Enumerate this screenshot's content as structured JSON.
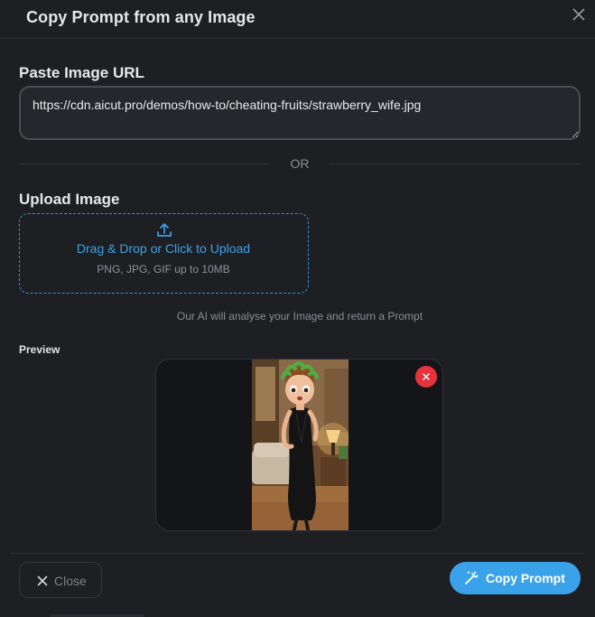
{
  "modal": {
    "title": "Copy Prompt from any Image"
  },
  "url_section": {
    "label": "Paste Image URL",
    "value": "https://cdn.aicut.pro/demos/how-to/cheating-fruits/strawberry_wife.jpg"
  },
  "divider": {
    "text": "OR"
  },
  "upload_section": {
    "label": "Upload Image",
    "drop_title": "Drag & Drop or Click to Upload",
    "drop_sub": "PNG, JPG, GIF up to 10MB",
    "note": "Our AI will analyse your Image and return a Prompt"
  },
  "preview": {
    "label": "Preview"
  },
  "footer": {
    "close_label": "Close",
    "copy_label": "Copy Prompt"
  },
  "colors": {
    "accent": "#3aa2e8",
    "danger": "#e5323b",
    "background": "#1e1f23"
  },
  "icons": {
    "close": "close-icon",
    "upload": "upload-icon",
    "remove": "remove-icon",
    "wand": "magic-wand-icon"
  }
}
